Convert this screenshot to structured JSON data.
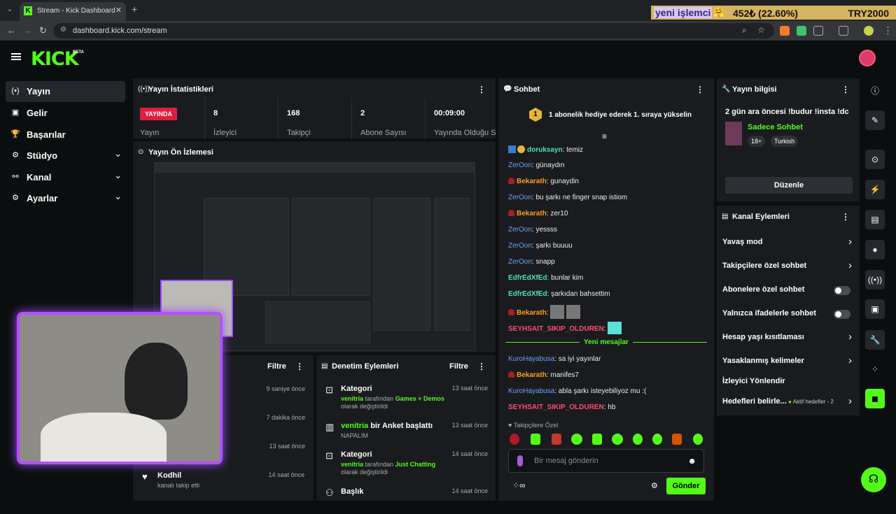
{
  "browser": {
    "tab_title": "Stream - Kick Dashboard",
    "tab_icon": "K",
    "url": "dashboard.kick.com/stream",
    "ticker": {
      "user": "yeni işlemci",
      "emoji": "🤗",
      "price": "452₺ (22.60%)",
      "pair": "TRY2000"
    }
  },
  "header": {
    "logo": "KICK",
    "beta": "BETA"
  },
  "sidebar": {
    "items": [
      {
        "label": "Yayın",
        "icon": "(•)"
      },
      {
        "label": "Gelir",
        "icon": "▣"
      },
      {
        "label": "Başarılar",
        "icon": "🏆"
      },
      {
        "label": "Stüdyo",
        "icon": "⚙"
      },
      {
        "label": "Kanal",
        "icon": "⚯"
      },
      {
        "label": "Ayarlar",
        "icon": "⚙"
      }
    ],
    "chevron": "⌄"
  },
  "stats": {
    "title": "Yayın İstatistikleri",
    "live": "YAYINDA",
    "stream_label": "Yayın",
    "items": [
      {
        "value": "8",
        "label": "İzleyici"
      },
      {
        "value": "168",
        "label": "Takipçi"
      },
      {
        "value": "2",
        "label": "Abone Sayısı"
      },
      {
        "value": "00:09:00",
        "label": "Yayında Olduğu Süre"
      }
    ]
  },
  "preview": {
    "title": "Yayın Ön İzlemesi"
  },
  "activity": {
    "filter": "Filtre",
    "items": [
      {
        "time": "9 saniye önce"
      },
      {
        "time": "7 dakika önce"
      },
      {
        "time": "13 saat önce"
      },
      {
        "title": "Kodhil",
        "sub": "kanalı takip etti",
        "time": "14 saat önce"
      }
    ]
  },
  "moderation": {
    "title": "Denetim Eylemleri",
    "filter": "Filtre",
    "items": [
      {
        "title": "Kategori",
        "by_user": "venitria",
        "by_text": "tarafından",
        "value": "Games + Demos",
        "suffix": "olarak değiştirildi",
        "time": "13 saat önce"
      },
      {
        "title_user": "venitria",
        "title": "bir Anket başlattı",
        "sub": "NAPALIM",
        "time": "13 saat önce"
      },
      {
        "title": "Kategori",
        "by_user": "venitria",
        "by_text": "tarafından",
        "value": "Just Chatting",
        "suffix": "olarak değiştirildi",
        "time": "14 saat önce"
      },
      {
        "title": "Başlık",
        "time": "14 saat önce"
      }
    ]
  },
  "chat": {
    "title": "Sohbet",
    "gift_badge": "1",
    "gift_text": "1 abonelik hediye ederek 1. sıraya yükselin",
    "messages": [
      {
        "user": "doruksayn",
        "text": "temiz"
      },
      {
        "user": "ZerOon",
        "text": "günaydın"
      },
      {
        "user": "Bekarath",
        "text": "gunaydin"
      },
      {
        "user": "ZerOon",
        "text": "bu şarkı ne finger snap istiom"
      },
      {
        "user": "Bekarath",
        "text": "zer10"
      },
      {
        "user": "ZerOon",
        "text": "yessss"
      },
      {
        "user": "ZerOon",
        "text": "şarkı buuuu"
      },
      {
        "user": "ZerOon",
        "text": "snapp"
      },
      {
        "user": "EdfrEdXfEd",
        "text": "bunlar kim"
      },
      {
        "user": "EdfrEdXfEd",
        "text": "şarkıdan bahsettim"
      },
      {
        "user": "Bekarath",
        "text": ""
      },
      {
        "user": "SEYHSAIT_SIKIP_OLDUREN",
        "text": ""
      }
    ],
    "new_label": "Yeni mesajlar",
    "new_messages": [
      {
        "user": "KuroHayabusa",
        "text": "sa iyi yayınlar"
      },
      {
        "user": "Bekarath",
        "text": "manifes7"
      },
      {
        "user": "KuroHayabusa",
        "text": "abla şarkı isteyebiliyoz mu :("
      },
      {
        "user": "SEYHSAIT_SIKIP_OLDUREN",
        "text": "hb"
      }
    ],
    "follower_only": "Takipçilere Özel",
    "placeholder": "Bir mesaj gönderin",
    "send": "Gönder"
  },
  "stream_info": {
    "title": "Yayın bilgisi",
    "stream_title": "2 gün ara öncesi !budur !insta !dc",
    "category": "Sadece Sohbet",
    "tags": [
      "18+",
      "Turkish"
    ],
    "edit": "Düzenle"
  },
  "channel_actions": {
    "title": "Kanal Eylemleri",
    "items": [
      {
        "label": "Yavaş mod",
        "type": "chevron"
      },
      {
        "label": "Takipçilere özel sohbet",
        "type": "chevron"
      },
      {
        "label": "Abonelere özel sohbet",
        "type": "toggle"
      },
      {
        "label": "Yalnızca ifadelerle sohbet",
        "type": "toggle"
      },
      {
        "label": "Hesap yaşı kısıtlaması",
        "type": "chevron"
      },
      {
        "label": "Yasaklanmış kelimeler",
        "type": "chevron"
      },
      {
        "label": "İzleyici Yönlendir",
        "type": "none"
      },
      {
        "label": "Hedefleri belirle...",
        "type": "chevron",
        "extra": "Aktif hedefler - 2"
      }
    ]
  },
  "colors": {
    "accent": "#53fc18",
    "panel": "#191b1f",
    "live": "#e31c3d"
  }
}
